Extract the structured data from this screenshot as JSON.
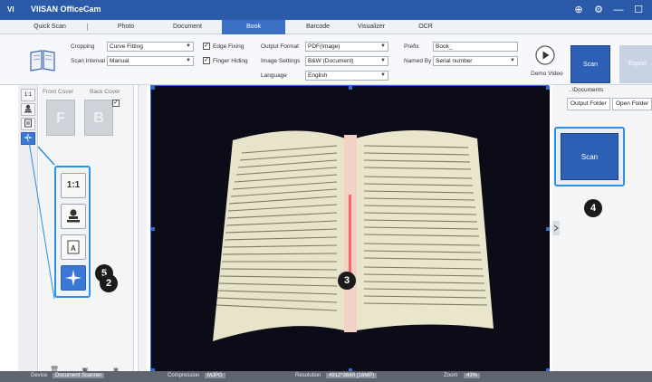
{
  "app": {
    "logo": "VI",
    "title": "VIISAN OfficeCam"
  },
  "window_controls": {
    "globe": "⊕",
    "settings": "⚙",
    "minimize": "—",
    "maximize": "☐"
  },
  "tabs": [
    {
      "label": "Quick Scan"
    },
    {
      "label": "Photo"
    },
    {
      "label": "Document"
    },
    {
      "label": "Book",
      "active": true
    },
    {
      "label": "Barcode"
    },
    {
      "label": "Visualizer"
    },
    {
      "label": "OCR"
    }
  ],
  "ribbon": {
    "cropping_label": "Cropping",
    "cropping_value": "Curve Fitting",
    "scan_interval_label": "Scan Interval",
    "scan_interval_value": "Manual",
    "edge_fixing_label": "Edge Fixing",
    "edge_fixing_checked": "✓",
    "finger_hiding_label": "Finger Hiding",
    "finger_hiding_checked": "✓",
    "output_format_label": "Output Format",
    "output_format_value": "PDF(Image)",
    "image_settings_label": "Image Settings",
    "image_settings_value": "B&W (Document)",
    "language_label": "Language",
    "language_value": "English",
    "prefix_label": "Prefix",
    "prefix_value": "Book_",
    "named_by_label": "Named By",
    "named_by_value": "Serial number",
    "demo_video_label": "Demo Video",
    "scan_label": "Scan",
    "export_label": "Export"
  },
  "left_strip": {
    "ratio_label": "1:1"
  },
  "thumbnails": {
    "front_cover_label": "Front Cover",
    "back_cover_label": "Back Cover",
    "front_letter": "F",
    "back_letter": "B",
    "back_checked": "✓"
  },
  "tool_callout": {
    "ratio_label": "1:1",
    "doc_label": "A"
  },
  "badges": {
    "b2": "2",
    "b3": "3",
    "b4": "4",
    "b5": "5"
  },
  "right_panel": {
    "path": "..\\Documents",
    "output_folder_label": "Output Folder",
    "open_folder_label": "Open Folder",
    "scan_big_label": "Scan"
  },
  "status": {
    "device_label": "Device",
    "device_value": "Document Scanner",
    "compression_label": "Compression",
    "compression_value": "MJPG",
    "resolution_label": "Resolution",
    "resolution_value": "4912*3680 (18MP)",
    "zoom_label": "Zoom",
    "zoom_value": "43%"
  }
}
